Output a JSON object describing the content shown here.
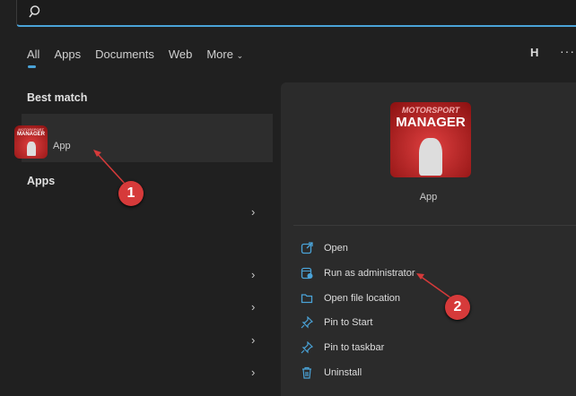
{
  "search": {
    "value": ""
  },
  "tabs": [
    {
      "label": "All"
    },
    {
      "label": "Apps"
    },
    {
      "label": "Documents"
    },
    {
      "label": "Web"
    },
    {
      "label": "More"
    }
  ],
  "account_initial": "H",
  "more_options": "···",
  "best_match": {
    "heading": "Best match",
    "app_label": "App"
  },
  "apps_heading": "Apps",
  "app_icon": {
    "line1": "MOTORSPORT",
    "line2": "MANAGER"
  },
  "panel": {
    "app_label": "App",
    "actions": [
      {
        "label": "Open",
        "icon": "open-icon"
      },
      {
        "label": "Run as administrator",
        "icon": "shield-window-icon"
      },
      {
        "label": "Open file location",
        "icon": "folder-icon"
      },
      {
        "label": "Pin to Start",
        "icon": "pin-icon"
      },
      {
        "label": "Pin to taskbar",
        "icon": "pin-icon"
      },
      {
        "label": "Uninstall",
        "icon": "trash-icon"
      }
    ]
  },
  "annotations": [
    "1",
    "2"
  ],
  "colors": {
    "accent": "#4aa3d8",
    "annotation": "#d63a3a"
  }
}
